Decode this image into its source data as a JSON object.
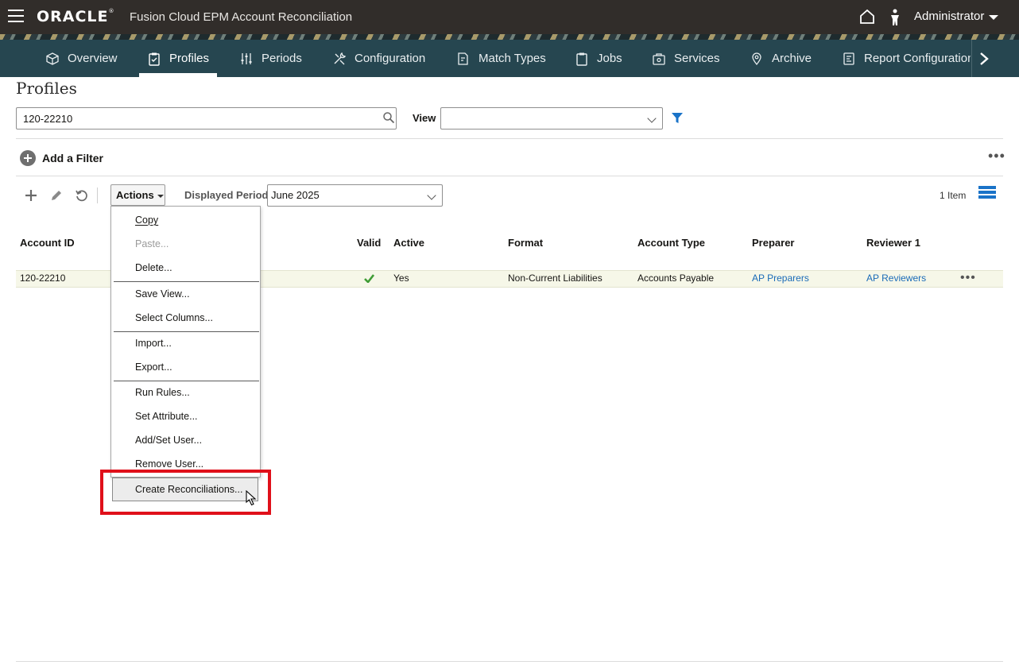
{
  "header": {
    "logo": "ORACLE",
    "app_title": "Fusion Cloud EPM Account Reconciliation",
    "user": "Administrator"
  },
  "nav": {
    "items": [
      {
        "label": "Overview",
        "icon": "cube-icon"
      },
      {
        "label": "Profiles",
        "icon": "clipboard-check-icon",
        "active": true
      },
      {
        "label": "Periods",
        "icon": "sliders-icon"
      },
      {
        "label": "Configuration",
        "icon": "tools-icon"
      },
      {
        "label": "Match Types",
        "icon": "document-edit-icon"
      },
      {
        "label": "Jobs",
        "icon": "clipboard-icon"
      },
      {
        "label": "Services",
        "icon": "briefcase-icon"
      },
      {
        "label": "Archive",
        "icon": "pin-icon"
      },
      {
        "label": "Report Configuration",
        "icon": "report-icon"
      }
    ]
  },
  "page": {
    "title": "Profiles",
    "search_value": "120-22210",
    "view_label": "View",
    "view_value": "",
    "add_filter_label": "Add a Filter"
  },
  "toolbar": {
    "actions_label": "Actions",
    "displayed_period_label": "Displayed Period",
    "displayed_period_value": "June 2025",
    "item_count": "1 Item"
  },
  "table": {
    "columns": [
      "Account ID",
      "Valid",
      "Active",
      "Format",
      "Account Type",
      "Preparer",
      "Reviewer 1"
    ],
    "rows": [
      {
        "account_id": "120-22210",
        "active": "Yes",
        "format": "Non-Current Liabilities",
        "account_type": "Accounts Payable",
        "preparer": "AP Preparers",
        "reviewer1": "AP Reviewers"
      }
    ]
  },
  "actions_menu": {
    "items": [
      {
        "label": "Copy"
      },
      {
        "label": "Paste...",
        "disabled": true
      },
      {
        "label": "Delete..."
      },
      {
        "label": "Save View..."
      },
      {
        "label": "Select Columns..."
      },
      {
        "label": "Import..."
      },
      {
        "label": "Export..."
      },
      {
        "label": "Run Rules..."
      },
      {
        "label": "Set Attribute..."
      },
      {
        "label": "Add/Set User..."
      },
      {
        "label": "Remove User..."
      },
      {
        "label": "Create Reconciliations...",
        "highlighted": true
      }
    ]
  },
  "colors": {
    "header_bg": "#312d2a",
    "nav_bg": "#264650",
    "link": "#1a6bb8",
    "highlight_box": "#e0101a",
    "valid_check": "#3f9c35"
  }
}
